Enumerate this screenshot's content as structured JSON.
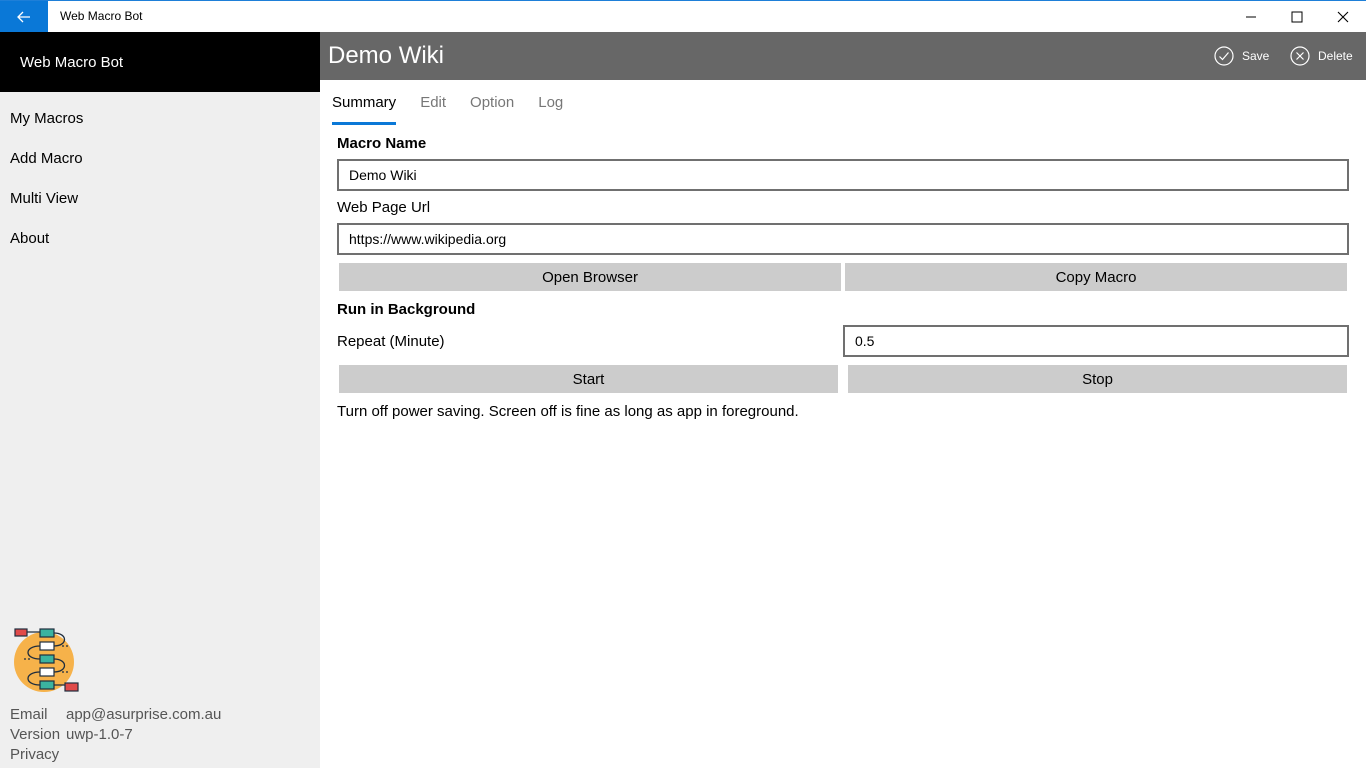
{
  "window": {
    "title": "Web Macro Bot"
  },
  "sidebar": {
    "header": "Web Macro Bot",
    "items": [
      {
        "label": "My Macros"
      },
      {
        "label": "Add Macro"
      },
      {
        "label": "Multi View"
      },
      {
        "label": "About"
      }
    ],
    "info": {
      "email_key": "Email",
      "email_value": "app@asurprise.com.au",
      "version_key": "Version",
      "version_value": "uwp-1.0-7",
      "privacy": "Privacy"
    }
  },
  "page": {
    "title": "Demo Wiki",
    "save_label": "Save",
    "delete_label": "Delete"
  },
  "tabs": [
    {
      "label": "Summary"
    },
    {
      "label": "Edit"
    },
    {
      "label": "Option"
    },
    {
      "label": "Log"
    }
  ],
  "form": {
    "macro_name_label": "Macro Name",
    "macro_name_value": "Demo Wiki",
    "url_label": "Web Page Url",
    "url_value": "https://www.wikipedia.org",
    "open_browser": "Open Browser",
    "copy_macro": "Copy Macro",
    "run_bg_label": "Run in Background",
    "repeat_label": "Repeat (Minute)",
    "repeat_value": "0.5",
    "start": "Start",
    "stop": "Stop",
    "note": "Turn off power saving. Screen off is fine as long as app in foreground."
  },
  "colors": {
    "accent": "#0a78d7",
    "header_bg": "#676767",
    "sidebar_bg": "#efefef",
    "button_bg": "#cccccc"
  }
}
